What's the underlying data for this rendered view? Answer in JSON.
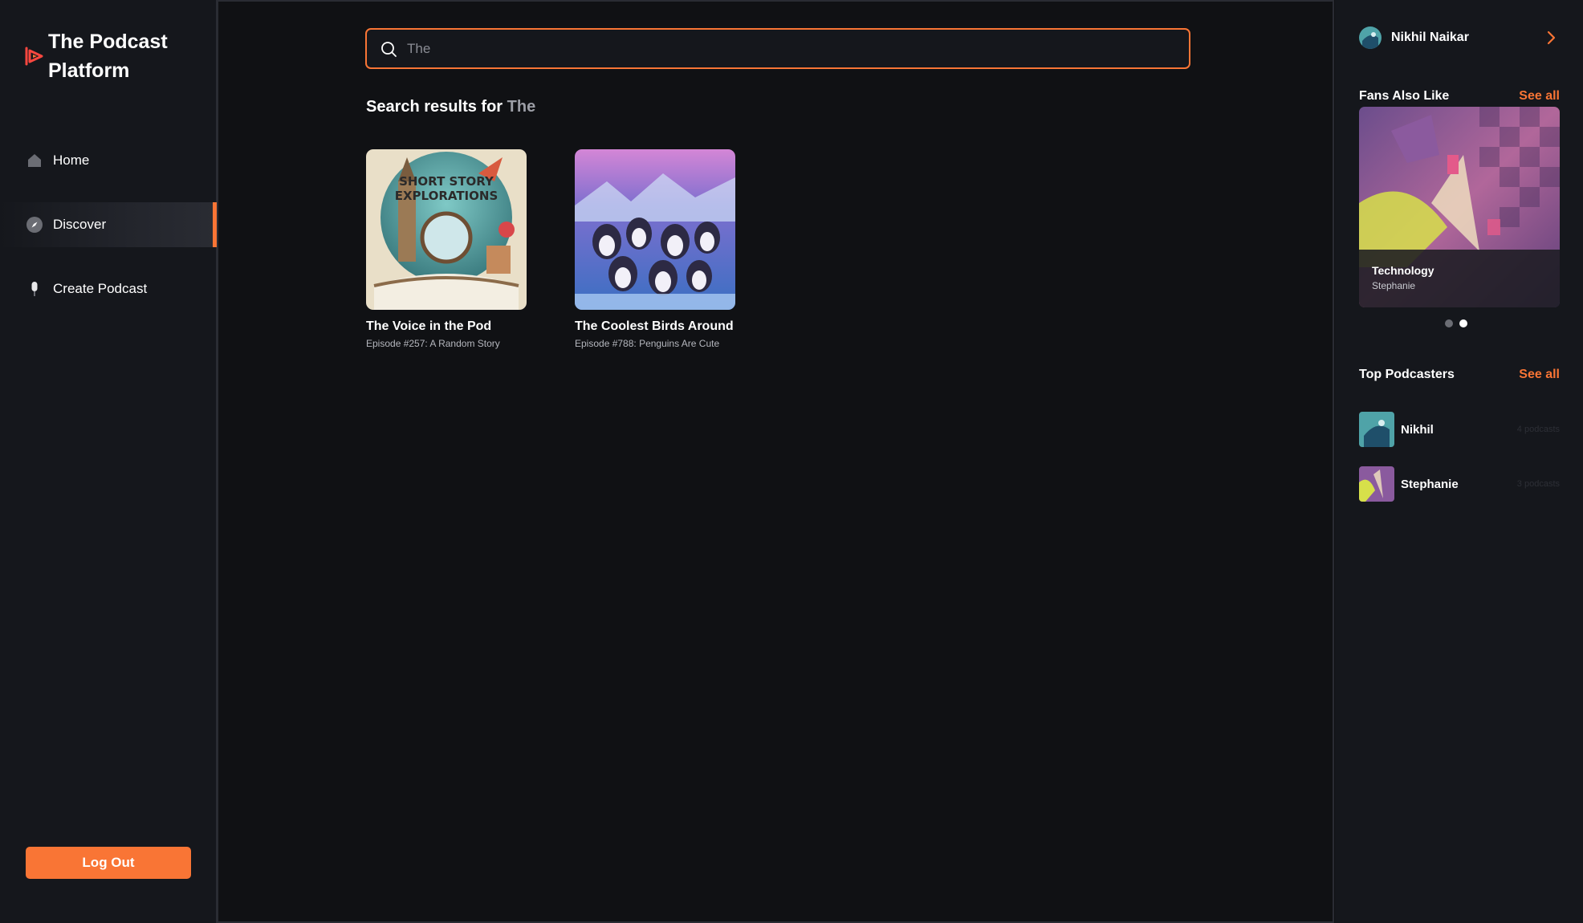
{
  "app": {
    "title_line1": "The Podcast",
    "title_line2": "Platform"
  },
  "nav": {
    "items": [
      {
        "label": "Home",
        "icon": "home-icon"
      },
      {
        "label": "Discover",
        "icon": "compass-icon",
        "active": true
      },
      {
        "label": "Create Podcast",
        "icon": "microphone-icon"
      }
    ]
  },
  "logout_label": "Log Out",
  "search": {
    "value": "The",
    "icon": "search-icon"
  },
  "results": {
    "prefix": "Search results for",
    "query": "The",
    "items": [
      {
        "title": "The Voice in the Pod",
        "subtitle": "Episode #257: A Random Story",
        "cover_text_1": "SHORT STORY",
        "cover_text_2": "EXPLORATIONS"
      },
      {
        "title": "The Coolest Birds Around",
        "subtitle": "Episode #788: Penguins Are Cute"
      }
    ]
  },
  "user": {
    "name": "Nikhil Naikar"
  },
  "fans_also_like": {
    "title": "Fans Also Like",
    "see_all": "See all",
    "featured": {
      "category": "Technology",
      "author": "Stephanie"
    },
    "slides": 2,
    "active_slide": 2
  },
  "top_podcasters": {
    "title": "Top Podcasters",
    "see_all": "See all",
    "items": [
      {
        "name": "Nikhil",
        "count": "4 podcasts"
      },
      {
        "name": "Stephanie",
        "count": "3 podcasts"
      }
    ]
  },
  "colors": {
    "accent": "#f97535",
    "bg": "#101114",
    "panel": "#15171c"
  }
}
